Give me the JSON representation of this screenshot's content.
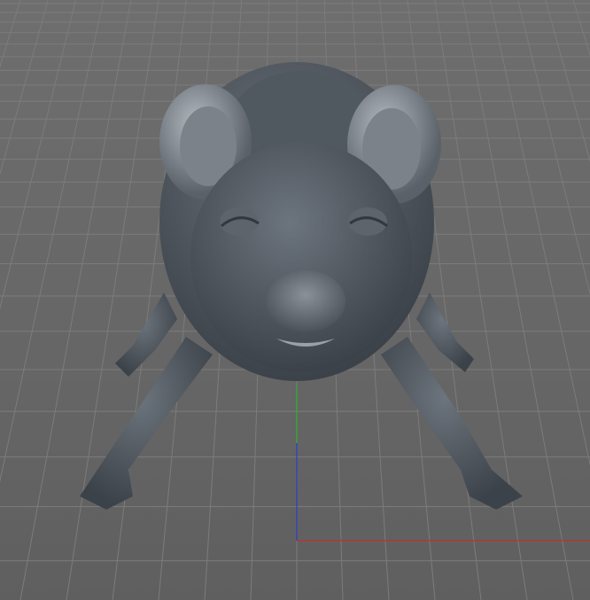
{
  "viewport": {
    "background": "#686868",
    "grid_color": "#7c7c7c",
    "model_color": "#4d545c",
    "axis_colors": {
      "x": "#c0302a",
      "y": "#2fb32f",
      "z": "#2a3fc8"
    }
  }
}
